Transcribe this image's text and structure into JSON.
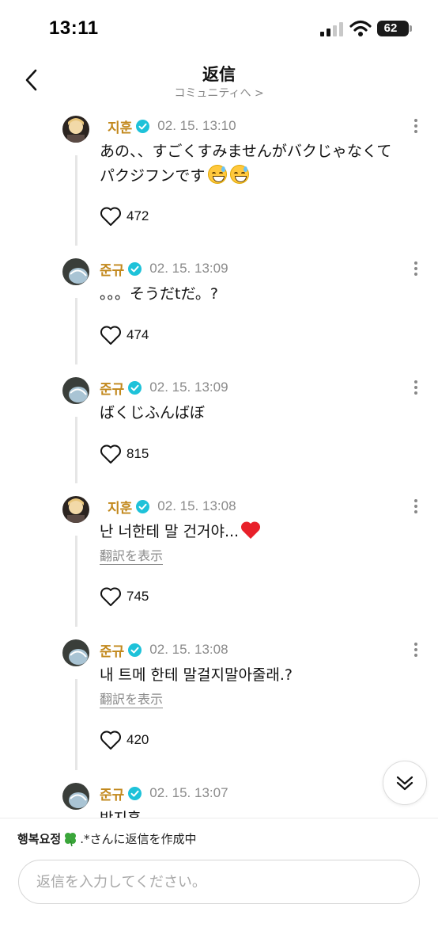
{
  "status_bar": {
    "time": "13:11",
    "battery": "62"
  },
  "header": {
    "title": "返信",
    "subtitle": "コミュニティへ >"
  },
  "comments": [
    {
      "user": "지훈",
      "date": "02. 15. 13:10",
      "text": "あの、、すごくすみませんがバクじゃなくて\nパクジフンです",
      "translate": "",
      "likes": "472"
    },
    {
      "user": "준규",
      "date": "02. 15. 13:09",
      "text": "。。。そうだtだ。?",
      "translate": "",
      "likes": "474"
    },
    {
      "user": "준규",
      "date": "02. 15. 13:09",
      "text": "ばくじふんばぼ",
      "translate": "",
      "likes": "815"
    },
    {
      "user": "지훈",
      "date": "02. 15. 13:08",
      "text": "난 너한테 말 건거야...",
      "translate": "翻訳を表示",
      "likes": "745"
    },
    {
      "user": "준규",
      "date": "02. 15. 13:08",
      "text": "내 트메 한테 말걸지말아줄래.?",
      "translate": "翻訳を表示",
      "likes": "420"
    },
    {
      "user": "준규",
      "date": "02. 15. 13:07",
      "text": "박지훈",
      "translate": "",
      "likes": ""
    }
  ],
  "footer": {
    "reply_user": "행복요정",
    "reply_suffix": ".*さんに返信を作成中",
    "input_placeholder": "返信を入力してください。"
  },
  "colors": {
    "username": "#c2881c",
    "verified": "#1ec2d9",
    "muted": "#8a8a8a"
  },
  "icons": [
    "back-arrow-icon",
    "verified-icon",
    "more-icon",
    "heart-icon",
    "chevron-double-down-icon",
    "clover-icon",
    "grinning-sweat-emoji",
    "red-heart-emoji"
  ]
}
